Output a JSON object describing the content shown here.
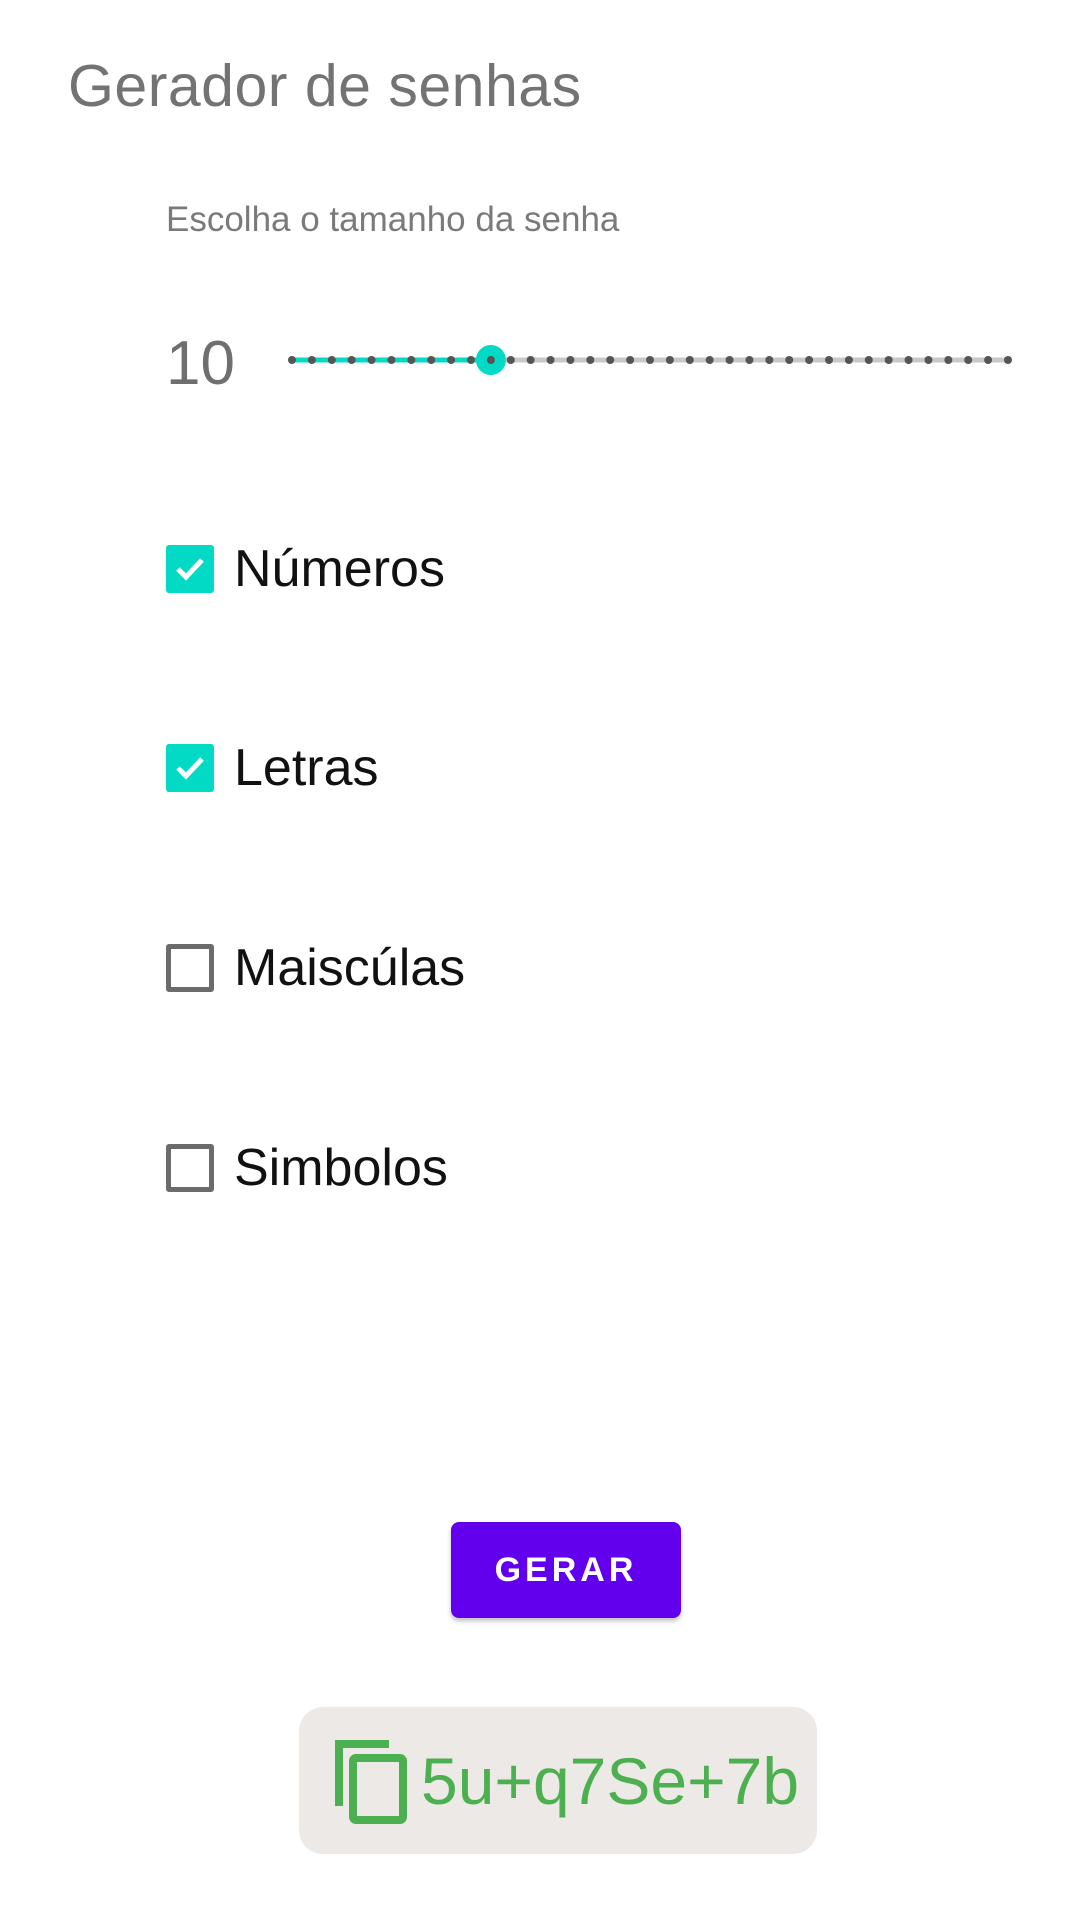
{
  "app": {
    "title": "Gerador de senhas"
  },
  "length": {
    "label": "Escolha o tamanho da senha",
    "value": "10",
    "slider_min": 0,
    "slider_max": 36,
    "slider_value": 10
  },
  "options": [
    {
      "label": "Números",
      "checked": true
    },
    {
      "label": "Letras",
      "checked": true
    },
    {
      "label": "Maiscúlas",
      "checked": false
    },
    {
      "label": "Simbolos",
      "checked": false
    }
  ],
  "actions": {
    "generate_label": "GERAR"
  },
  "result": {
    "password": "5u+q7Se+7b",
    "icon": "copy-icon"
  },
  "colors": {
    "accent": "#03dac5",
    "primary": "#6200ee",
    "result_text": "#4caf50",
    "result_bg": "#ede9e6"
  }
}
